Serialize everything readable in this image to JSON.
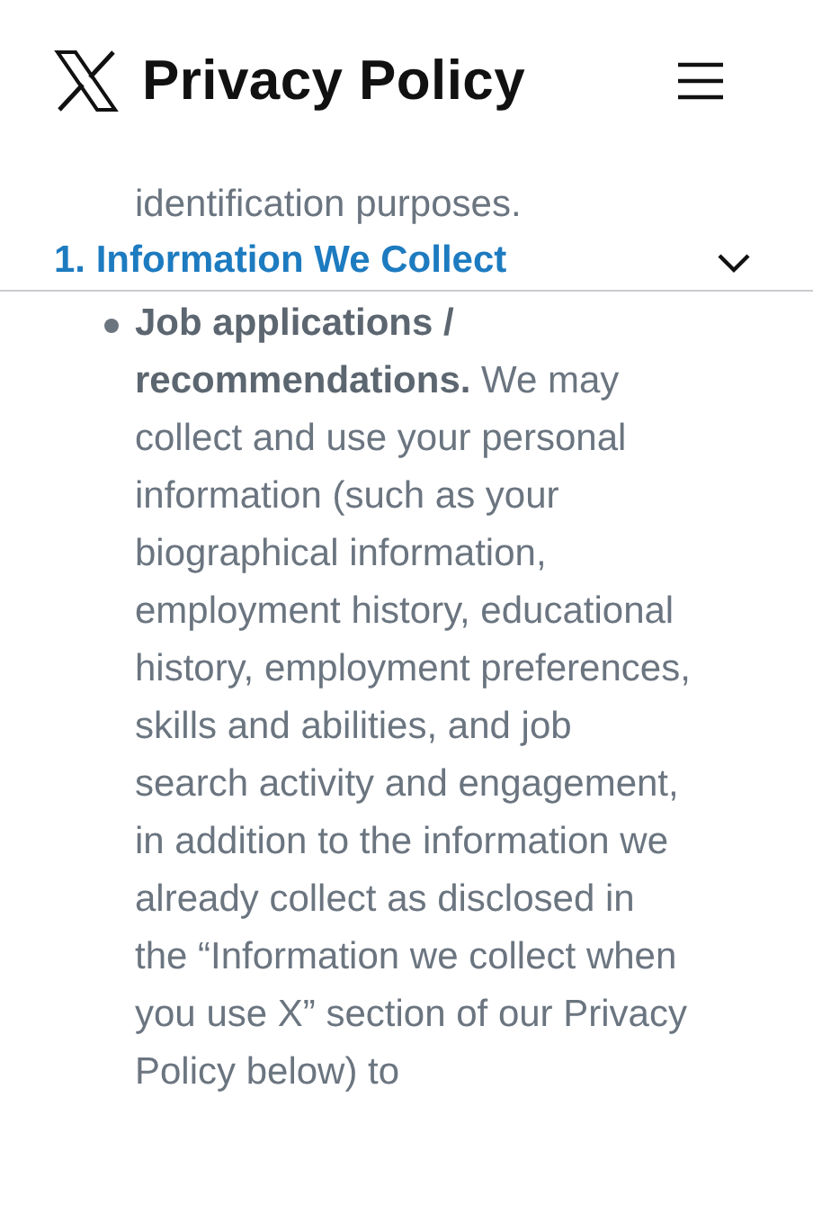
{
  "header": {
    "title": "Privacy Policy"
  },
  "content_above": {
    "text": "identification purposes."
  },
  "section_bar": {
    "title": "1. Information We Collect",
    "expanded": false
  },
  "bullets": [
    {
      "text": "**Job applications / recommendations.** We may collect and use your personal information (such as your biographical information, employment history, educational history, employment preferences, skills and abilities, and job search activity and engagement, in addition to the information we already collect as disclosed in the “Information we collect when you use X” section of our Privacy Policy below) to"
    }
  ]
}
